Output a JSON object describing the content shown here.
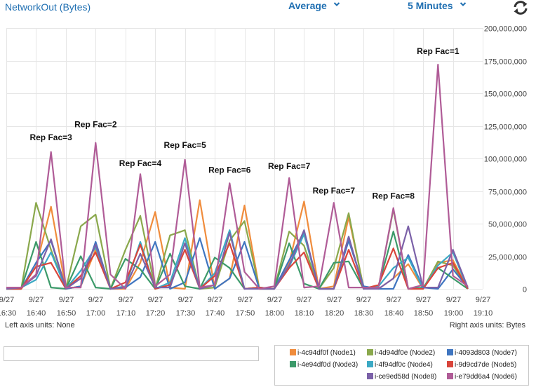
{
  "header": {
    "metric_title": "NetworkOut (Bytes)",
    "statistic": "Average",
    "period": "5 Minutes",
    "refresh_icon": "refresh-icon"
  },
  "footer": {
    "left_units": "Left axis units:  None",
    "right_units": "Right axis units:  Bytes"
  },
  "range_input": {
    "value": ""
  },
  "colors": {
    "grid": "#e6e6e6",
    "axis_text": "#444444",
    "annotation": "#111111"
  },
  "chart_data": {
    "type": "line",
    "title": "NetworkOut (Bytes)",
    "x": [
      "16:30",
      "16:35",
      "16:40",
      "16:45",
      "16:50",
      "16:55",
      "17:00",
      "17:05",
      "17:10",
      "17:15",
      "17:20",
      "17:25",
      "17:30",
      "17:35",
      "17:40",
      "17:45",
      "17:50",
      "17:55",
      "18:00",
      "18:05",
      "18:10",
      "18:15",
      "18:20",
      "18:25",
      "18:30",
      "18:35",
      "18:40",
      "18:45",
      "18:50",
      "18:55",
      "19:00",
      "19:05"
    ],
    "x_ticks": [
      {
        "x": "16:30",
        "date": "9/27",
        "time": "16:30"
      },
      {
        "x": "16:40",
        "date": "9/27",
        "time": "16:40"
      },
      {
        "x": "16:50",
        "date": "9/27",
        "time": "16:50"
      },
      {
        "x": "17:00",
        "date": "9/27",
        "time": "17:00"
      },
      {
        "x": "17:10",
        "date": "9/27",
        "time": "17:10"
      },
      {
        "x": "17:20",
        "date": "9/27",
        "time": "17:20"
      },
      {
        "x": "17:30",
        "date": "9/27",
        "time": "17:30"
      },
      {
        "x": "17:40",
        "date": "9/27",
        "time": "17:40"
      },
      {
        "x": "17:50",
        "date": "9/27",
        "time": "17:50"
      },
      {
        "x": "18:00",
        "date": "9/27",
        "time": "18:00"
      },
      {
        "x": "18:10",
        "date": "9/27",
        "time": "18:10"
      },
      {
        "x": "18:20",
        "date": "9/27",
        "time": "18:20"
      },
      {
        "x": "18:30",
        "date": "9/27",
        "time": "18:30"
      },
      {
        "x": "18:40",
        "date": "9/27",
        "time": "18:40"
      },
      {
        "x": "18:50",
        "date": "9/27",
        "time": "18:50"
      },
      {
        "x": "19:00",
        "date": "9/27",
        "time": "19:00"
      },
      {
        "x": "19:10",
        "date": "9/27",
        "time": "19:10"
      }
    ],
    "xlim": [
      "16:30",
      "19:10"
    ],
    "ylim": [
      0,
      200000000
    ],
    "yticks": [
      {
        "value": 0,
        "label": "0"
      },
      {
        "value": 25000000,
        "label": "25,000,000"
      },
      {
        "value": 50000000,
        "label": "50,000,000"
      },
      {
        "value": 75000000,
        "label": "75,000,000"
      },
      {
        "value": 100000000,
        "label": "100,000,000"
      },
      {
        "value": 125000000,
        "label": "125,000,000"
      },
      {
        "value": 150000000,
        "label": "150,000,000"
      },
      {
        "value": 175000000,
        "label": "175,000,000"
      },
      {
        "value": 200000000,
        "label": "200,000,000"
      }
    ],
    "y_axis_side": "right",
    "grid": true,
    "legend_position": "bottom-right",
    "series": [
      {
        "name": "i-4c94df0f (Node1)",
        "color": "#f08c3c",
        "values": [
          0,
          0,
          17000000,
          63000000,
          0,
          2000000,
          30000000,
          0,
          0,
          20000000,
          59000000,
          1000000,
          0,
          68000000,
          0,
          8000000,
          64000000,
          0,
          0,
          20000000,
          67000000,
          0,
          2000000,
          55000000,
          1000000,
          0,
          8000000,
          19000000,
          0,
          20000000,
          22000000,
          0
        ]
      },
      {
        "name": "i-4d94df0e (Node2)",
        "color": "#8aa84c",
        "values": [
          0,
          0,
          66000000,
          30000000,
          0,
          48000000,
          57000000,
          0,
          30000000,
          56000000,
          0,
          41000000,
          45000000,
          0,
          1000000,
          37000000,
          52000000,
          0,
          0,
          44000000,
          33000000,
          0,
          16000000,
          58000000,
          0,
          1000000,
          61000000,
          0,
          0,
          21000000,
          18000000,
          0
        ]
      },
      {
        "name": "i-4093d803 (Node7)",
        "color": "#3f75c0",
        "values": [
          0,
          0,
          20000000,
          37000000,
          0,
          2000000,
          36000000,
          0,
          1000000,
          9000000,
          36000000,
          0,
          5000000,
          39000000,
          0,
          8000000,
          36000000,
          0,
          0,
          22000000,
          44000000,
          0,
          0,
          37000000,
          2000000,
          0,
          0,
          26000000,
          1000000,
          0,
          15000000,
          1000000
        ]
      },
      {
        "name": "i-4e94df0d (Node3)",
        "color": "#3c9a6a",
        "values": [
          0,
          0,
          36000000,
          1000000,
          0,
          25000000,
          1000000,
          0,
          23000000,
          15000000,
          0,
          27000000,
          2000000,
          0,
          24000000,
          16000000,
          0,
          1000000,
          0,
          35000000,
          4000000,
          0,
          20000000,
          21000000,
          0,
          2000000,
          44000000,
          0,
          1000000,
          16000000,
          8000000,
          0
        ]
      },
      {
        "name": "i-4f94df0c (Node4)",
        "color": "#3ba9c4",
        "values": [
          0,
          1000000,
          7000000,
          28000000,
          0,
          14000000,
          32000000,
          0,
          2000000,
          36000000,
          0,
          5000000,
          39000000,
          0,
          12000000,
          45000000,
          0,
          1000000,
          0,
          17000000,
          42000000,
          0,
          0,
          40000000,
          0,
          2000000,
          16000000,
          24000000,
          0,
          18000000,
          28000000,
          0
        ]
      },
      {
        "name": "i-9d9cd7de (Node5)",
        "color": "#d9453b",
        "values": [
          0,
          0,
          17000000,
          20000000,
          0,
          10000000,
          28000000,
          0,
          5000000,
          34000000,
          0,
          3000000,
          30000000,
          0,
          10000000,
          35000000,
          0,
          1000000,
          0,
          16000000,
          28000000,
          0,
          0,
          30000000,
          0,
          3000000,
          31000000,
          0,
          0,
          16000000,
          20000000,
          0
        ]
      },
      {
        "name": "i-ce9ed58d (Node8)",
        "color": "#7b61a8",
        "values": [
          0,
          1000000,
          10000000,
          38000000,
          0,
          8000000,
          34000000,
          0,
          1000000,
          27000000,
          1000000,
          1000000,
          35000000,
          0,
          3000000,
          43000000,
          0,
          0,
          0,
          18000000,
          45000000,
          0,
          0,
          40000000,
          0,
          0,
          8000000,
          48000000,
          1000000,
          1000000,
          30000000,
          1000000
        ]
      },
      {
        "name": "i-e79dd6a4 (Node6)",
        "color": "#b05c97",
        "values": [
          1000000,
          1000000,
          11000000,
          105000000,
          1000000,
          1000000,
          112000000,
          11000000,
          0,
          88000000,
          2000000,
          11000000,
          99000000,
          1000000,
          3000000,
          81000000,
          13000000,
          0,
          2000000,
          85000000,
          1000000,
          2000000,
          66000000,
          1000000,
          1000000,
          1000000,
          62000000,
          0,
          3000000,
          172000000,
          10000000,
          2000000
        ]
      }
    ],
    "annotations": [
      {
        "text": "Rep Fac=3",
        "x": "16:45",
        "y": 114000000
      },
      {
        "text": "Rep Fac=2",
        "x": "17:00",
        "y": 124000000
      },
      {
        "text": "Rep Fac=4",
        "x": "17:15",
        "y": 94000000
      },
      {
        "text": "Rep Fac=5",
        "x": "17:30",
        "y": 108000000
      },
      {
        "text": "Rep Fac=6",
        "x": "17:45",
        "y": 89000000
      },
      {
        "text": "Rep Fac=7",
        "x": "18:05",
        "y": 92000000
      },
      {
        "text": "Rep Fac=7",
        "x": "18:20",
        "y": 73000000
      },
      {
        "text": "Rep Fac=8",
        "x": "18:40",
        "y": 69000000
      },
      {
        "text": "Rep Fac=1",
        "x": "18:55",
        "y": 180000000
      }
    ]
  },
  "legend": [
    {
      "series": 0,
      "label": "i-4c94df0f (Node1)"
    },
    {
      "series": 1,
      "label": "i-4d94df0e (Node2)"
    },
    {
      "series": 2,
      "label": "i-4093d803 (Node7)"
    },
    {
      "series": 3,
      "label": "i-4e94df0d (Node3)"
    },
    {
      "series": 4,
      "label": "i-4f94df0c (Node4)"
    },
    {
      "series": 5,
      "label": "i-9d9cd7de (Node5)"
    },
    {
      "series": 6,
      "label": "i-ce9ed58d (Node8)"
    },
    {
      "series": 7,
      "label": "i-e79dd6a4 (Node6)"
    }
  ]
}
